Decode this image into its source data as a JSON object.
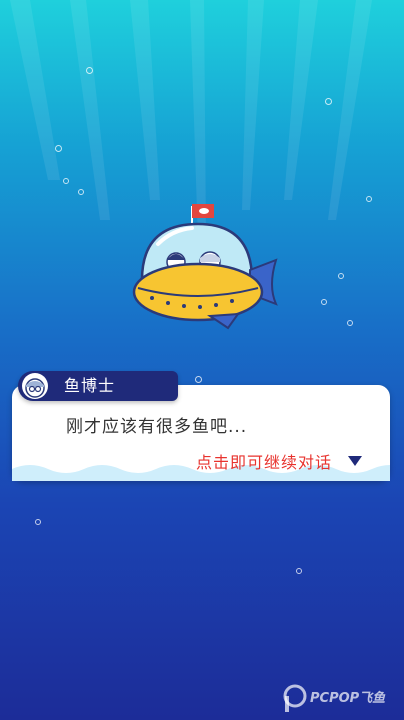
{
  "scene": {
    "background_top": "#1fd0dc",
    "background_bottom": "#1c2c98",
    "illustration": "yellow-submarine-with-fish-tail"
  },
  "dialog": {
    "speaker": "鱼博士",
    "speaker_avatar": "doctor-fish-avatar-icon",
    "text": "刚才应该有很多鱼吧...",
    "continue_hint": "点击即可继续对话",
    "hint_color": "#e8332e"
  },
  "watermark": {
    "text": "PCPOP飞鱼"
  }
}
